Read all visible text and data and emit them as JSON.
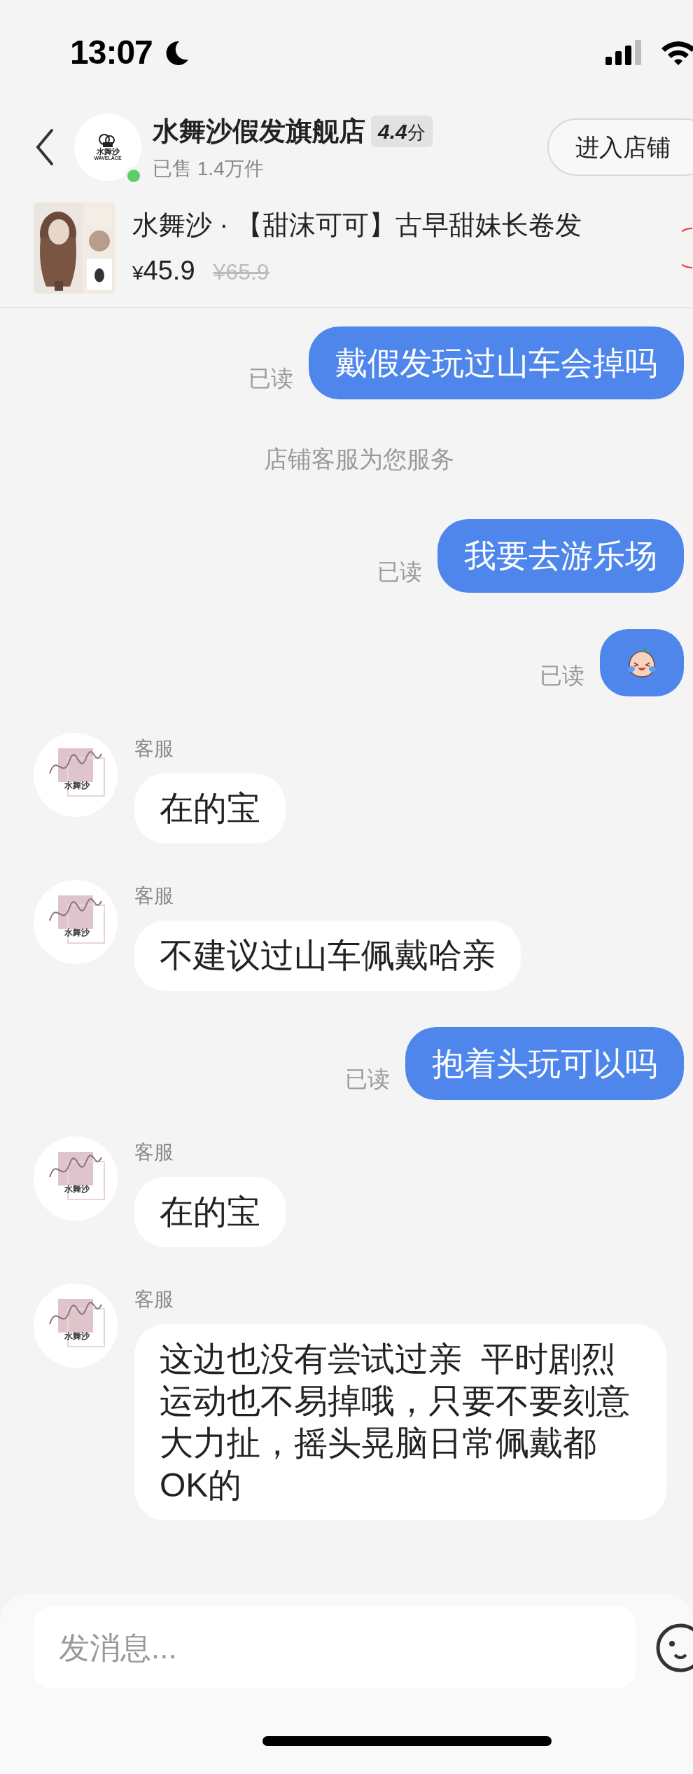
{
  "status_bar": {
    "time": "13:07"
  },
  "header": {
    "store": {
      "name": "水舞沙假发旗舰店",
      "rating": "4.4",
      "rating_unit": "分",
      "sold": "已售 1.4万件",
      "online": true,
      "logo_text": [
        "水舞沙",
        "WAVELACE"
      ]
    },
    "enter_button": "进入店铺"
  },
  "product": {
    "title": "水舞沙 · 【甜沫可可】古早甜妹长卷发",
    "price_symbol": "¥",
    "price": "45.9",
    "original_price": "¥65.9"
  },
  "messages": [
    {
      "kind": "outgoing",
      "text": "戴假发玩过山车会掉吗",
      "status": "已读"
    },
    {
      "kind": "notice",
      "text": "店铺客服为您服务"
    },
    {
      "kind": "outgoing",
      "text": "我要去游乐场",
      "status": "已读"
    },
    {
      "kind": "outgoing_emoji",
      "status": "已读"
    },
    {
      "kind": "incoming",
      "sender": "客服",
      "avatar_label": "水舞沙",
      "text": "在的宝"
    },
    {
      "kind": "incoming",
      "sender": "客服",
      "avatar_label": "水舞沙",
      "text": "不建议过山车佩戴哈亲"
    },
    {
      "kind": "outgoing",
      "text": "抱着头玩可以吗",
      "status": "已读"
    },
    {
      "kind": "incoming",
      "sender": "客服",
      "avatar_label": "水舞沙",
      "text": "在的宝"
    },
    {
      "kind": "incoming",
      "sender": "客服",
      "avatar_label": "水舞沙",
      "text": "这边也没有尝试过亲  平时剧烈运动也不易掉哦，只要不要刻意大力扯，摇头晃脑日常佩戴都OK的"
    }
  ],
  "input": {
    "placeholder": "发消息..."
  }
}
